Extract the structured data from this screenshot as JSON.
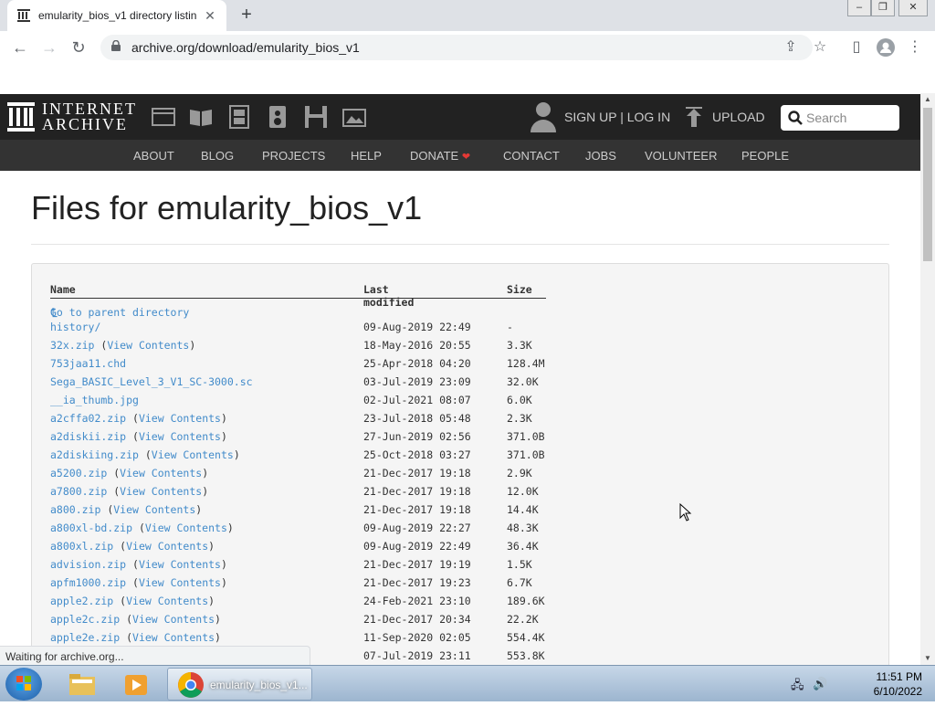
{
  "browser": {
    "tab_title": "emularity_bios_v1 directory listin",
    "url": "archive.org/download/emularity_bios_v1",
    "status": "Waiting for archive.org..."
  },
  "ia": {
    "logo_line1": "INTERNET",
    "logo_line2": "ARCHIVE",
    "signup": "SIGN UP | LOG IN",
    "upload": "UPLOAD",
    "search_placeholder": "Search",
    "nav": [
      "ABOUT",
      "BLOG",
      "PROJECTS",
      "HELP",
      "DONATE",
      "CONTACT",
      "JOBS",
      "VOLUNTEER",
      "PEOPLE"
    ],
    "heart_color": "#e53935"
  },
  "page": {
    "heading": "Files for emularity_bios_v1",
    "columns": [
      "Name",
      "Last modified",
      "Size"
    ],
    "parent": "Go to parent directory",
    "files": [
      {
        "name": "history/",
        "view": "",
        "date": "09-Aug-2019 22:49",
        "size": "-"
      },
      {
        "name": "32x.zip",
        "view": "View Contents",
        "date": "18-May-2016 20:55",
        "size": "3.3K"
      },
      {
        "name": "753jaa11.chd",
        "view": "",
        "date": "25-Apr-2018 04:20",
        "size": "128.4M"
      },
      {
        "name": "Sega_BASIC_Level_3_V1_SC-3000.sc",
        "view": "",
        "date": "03-Jul-2019 23:09",
        "size": "32.0K"
      },
      {
        "name": "__ia_thumb.jpg",
        "view": "",
        "date": "02-Jul-2021 08:07",
        "size": "6.0K"
      },
      {
        "name": "a2cffa02.zip",
        "view": "View Contents",
        "date": "23-Jul-2018 05:48",
        "size": "2.3K"
      },
      {
        "name": "a2diskii.zip",
        "view": "View Contents",
        "date": "27-Jun-2019 02:56",
        "size": "371.0B"
      },
      {
        "name": "a2diskiing.zip",
        "view": "View Contents",
        "date": "25-Oct-2018 03:27",
        "size": "371.0B"
      },
      {
        "name": "a5200.zip",
        "view": "View Contents",
        "date": "21-Dec-2017 19:18",
        "size": "2.9K"
      },
      {
        "name": "a7800.zip",
        "view": "View Contents",
        "date": "21-Dec-2017 19:18",
        "size": "12.0K"
      },
      {
        "name": "a800.zip",
        "view": "View Contents",
        "date": "21-Dec-2017 19:18",
        "size": "14.4K"
      },
      {
        "name": "a800xl-bd.zip",
        "view": "View Contents",
        "date": "09-Aug-2019 22:27",
        "size": "48.3K"
      },
      {
        "name": "a800xl.zip",
        "view": "View Contents",
        "date": "09-Aug-2019 22:49",
        "size": "36.4K"
      },
      {
        "name": "advision.zip",
        "view": "View Contents",
        "date": "21-Dec-2017 19:19",
        "size": "1.5K"
      },
      {
        "name": "apfm1000.zip",
        "view": "View Contents",
        "date": "21-Dec-2017 19:23",
        "size": "6.7K"
      },
      {
        "name": "apple2.zip",
        "view": "View Contents",
        "date": "24-Feb-2021 23:10",
        "size": "189.6K"
      },
      {
        "name": "apple2c.zip",
        "view": "View Contents",
        "date": "21-Dec-2017 20:34",
        "size": "22.2K"
      },
      {
        "name": "apple2e.zip",
        "view": "View Contents",
        "date": "11-Sep-2020 02:05",
        "size": "554.4K"
      },
      {
        "name": "",
        "view": "",
        "date": "07-Jul-2019 23:11",
        "size": "553.8K"
      }
    ]
  },
  "taskbar": {
    "active_app": "emularity_bios_v1...",
    "time": "11:51 PM",
    "date": "6/10/2022"
  }
}
